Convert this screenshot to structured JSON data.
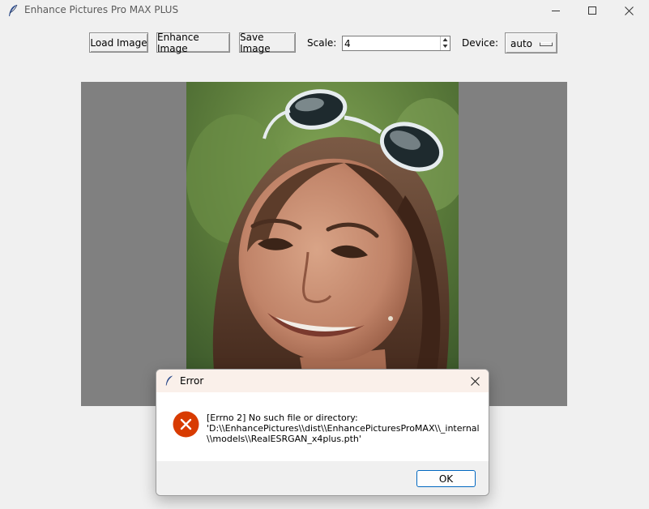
{
  "window": {
    "title": "Enhance Pictures Pro MAX PLUS",
    "icon": "feather-icon",
    "controls": [
      "minimize-icon",
      "maximize-icon",
      "close-icon"
    ]
  },
  "toolbar": {
    "load_label": "Load Image",
    "enhance_label": "Enhance Image",
    "save_label": "Save Image",
    "scale_label": "Scale:",
    "scale_value": "4",
    "device_label": "Device:",
    "device_value": "auto"
  },
  "canvas": {
    "background": "#808080",
    "image": "portrait-photo"
  },
  "dialog": {
    "title": "Error",
    "icon": "error-icon",
    "message_lines": [
      "[Errno 2] No such file or directory:",
      "'D:\\\\EnhancePictures\\\\dist\\\\EnhancePicturesProMAX\\\\_internal",
      "\\\\models\\\\RealESRGAN_x4plus.pth'"
    ],
    "ok_label": "OK"
  },
  "colors": {
    "error_red": "#d83b01",
    "ok_border": "#0067c0",
    "dialog_header": "#faf0ea"
  }
}
